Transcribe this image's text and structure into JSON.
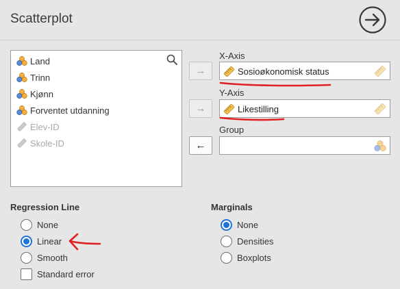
{
  "header": {
    "title": "Scatterplot",
    "run_icon": "arrow-right-circle-icon"
  },
  "variables": [
    {
      "label": "Land",
      "icon": "nominal-icon",
      "disabled": false
    },
    {
      "label": "Trinn",
      "icon": "nominal-icon",
      "disabled": false
    },
    {
      "label": "Kjønn",
      "icon": "nominal-icon",
      "disabled": false
    },
    {
      "label": "Forventet utdanning",
      "icon": "nominal-icon",
      "disabled": false
    },
    {
      "label": "Elev-ID",
      "icon": "id-icon",
      "disabled": true
    },
    {
      "label": "Skole-ID",
      "icon": "id-icon",
      "disabled": true
    }
  ],
  "xaxis": {
    "label": "X-Axis",
    "value": "Sosioøkonomisk status",
    "move_arrow": "→"
  },
  "yaxis": {
    "label": "Y-Axis",
    "value": "Likestilling",
    "move_arrow": "→"
  },
  "group": {
    "label": "Group",
    "value": "",
    "move_arrow": "←"
  },
  "regression": {
    "title": "Regression Line",
    "options": [
      {
        "label": "None",
        "checked": false
      },
      {
        "label": "Linear",
        "checked": true
      },
      {
        "label": "Smooth",
        "checked": false
      }
    ],
    "standard_error": {
      "label": "Standard error",
      "checked": false
    }
  },
  "marginals": {
    "title": "Marginals",
    "options": [
      {
        "label": "None",
        "checked": true
      },
      {
        "label": "Densities",
        "checked": false
      },
      {
        "label": "Boxplots",
        "checked": false
      }
    ]
  },
  "colors": {
    "accent": "#1d74d6",
    "background": "#e6e6e6",
    "annotation": "#e02020",
    "nominal_icon": "#f0a636",
    "continuous_icon": "#e8b04a"
  }
}
